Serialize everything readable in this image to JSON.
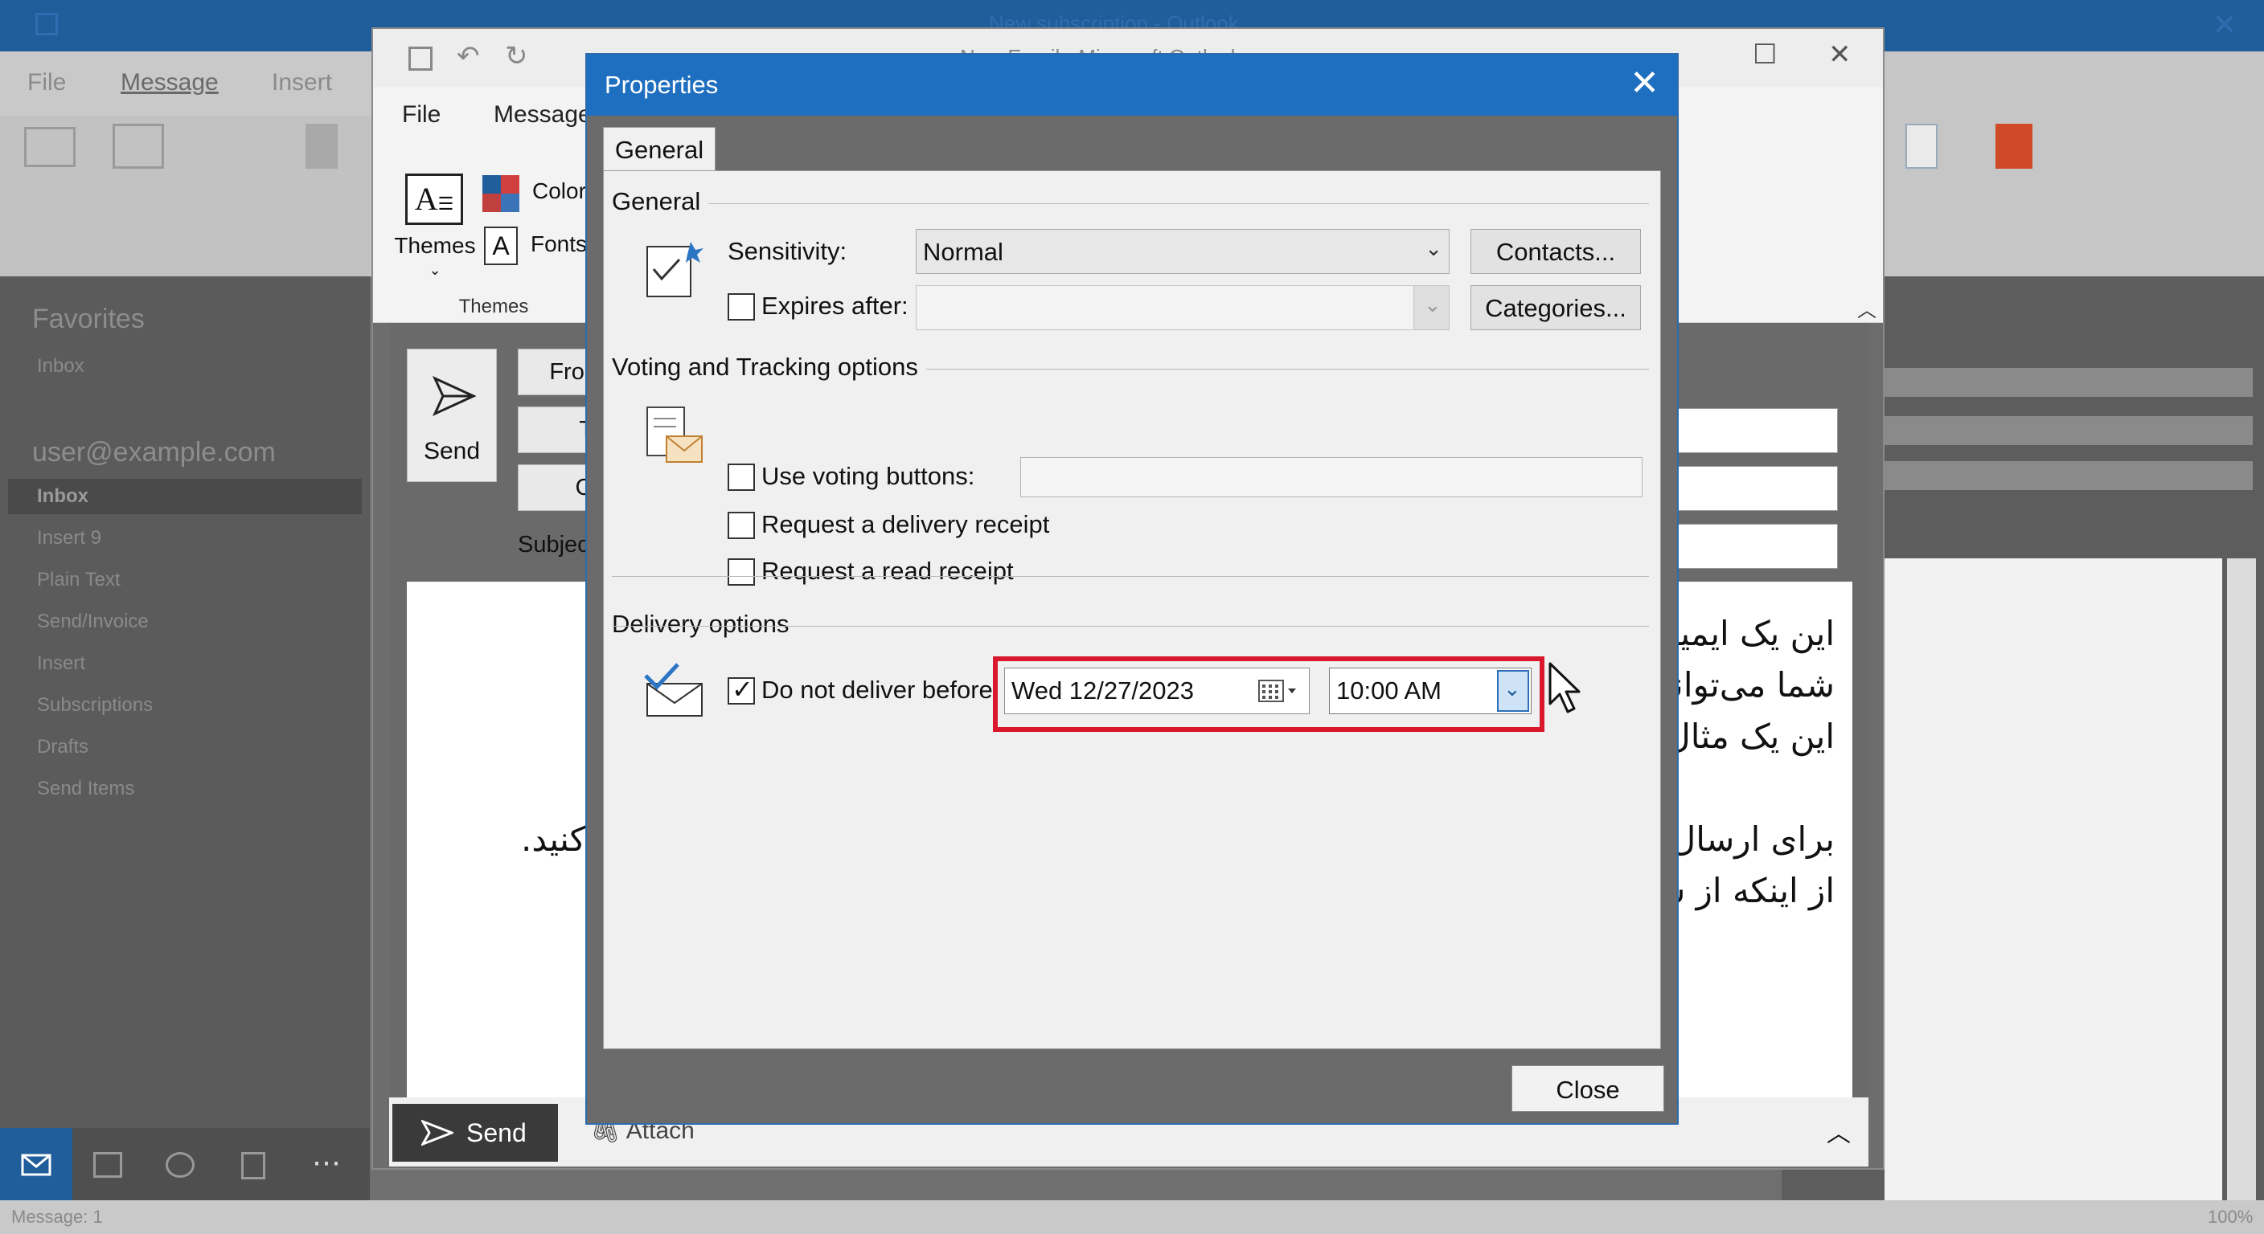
{
  "outlook": {
    "title": "New subscription - Outlook",
    "tabs": [
      "File",
      "Message",
      "Insert"
    ],
    "nav": {
      "favorites": "Favorites",
      "favorites_inbox": "Inbox",
      "account": "user@example.com",
      "items": [
        "Inbox",
        "Insert 9",
        "Plain Text",
        "Send/Invoice",
        "Insert",
        "Subscriptions",
        "Drafts",
        "Send Items"
      ]
    },
    "status": "Message: 1",
    "zoom": "100%"
  },
  "compose": {
    "title": "New Email - Microsoft Outlook",
    "tabs": [
      "File",
      "Message"
    ],
    "themes": {
      "label": "Themes",
      "group": "Themes",
      "colors": "Colors",
      "fonts": "Fonts"
    },
    "send_label": "Send",
    "from_label": "From",
    "to_label": "To",
    "cc_label": "Cc",
    "subject_label": "Subject:",
    "body_lines": [
      "این یک ایمیل",
      "شما می‌توانید",
      "این یک مثال",
      "برای ارسال، ل",
      "از اینکه از سی"
    ],
    "body_line_left": "کنید.",
    "footer_send": "Send",
    "attach": "Attach"
  },
  "dialog": {
    "title": "Properties",
    "tab": "General",
    "general": {
      "heading": "General",
      "sensitivity_label": "Sensitivity:",
      "sensitivity_value": "Normal",
      "expires_label": "Expires after:",
      "expires_checked": false,
      "contacts_button": "Contacts...",
      "categories_button": "Categories..."
    },
    "voting": {
      "heading": "Voting and Tracking options",
      "voting_label": "Use voting buttons:",
      "delivery_receipt": "Request a delivery receipt",
      "read_receipt": "Request a read receipt"
    },
    "delivery": {
      "heading": "Delivery options",
      "do_not_deliver_label": "Do not deliver before",
      "do_not_deliver_checked": true,
      "date": "Wed 12/27/2023",
      "time": "10:00 AM"
    },
    "close_button": "Close",
    "highlight_color": "#d9182e"
  }
}
